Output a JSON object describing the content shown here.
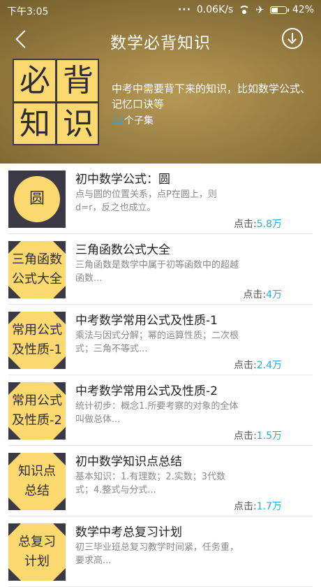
{
  "status_bar": {
    "time": "下午3:05",
    "speed": "0.06K/s",
    "battery": "42%"
  },
  "header": {
    "title": "数学必背知识",
    "description": "中考中需要背下来的知识，比如数学公式、记忆口诀等",
    "subset_count": "12",
    "subset_suffix": "个子集"
  },
  "cover": {
    "chars": [
      "必",
      "背",
      "知",
      "识"
    ]
  },
  "clicks_label": "点击:",
  "items": [
    {
      "title": "初中数学公式：圆",
      "subtitle": "点与圆的位置关系，点P在圆上，则d=r，反之也成立。",
      "clicks": "5.8万",
      "thumb_lines": [
        "圆"
      ]
    },
    {
      "title": "三角函数公式大全",
      "subtitle": "三角函数是数学中属于初等函数中的超越函数...",
      "clicks": "4万",
      "thumb_lines": [
        "三角函数",
        "公式大全"
      ]
    },
    {
      "title": "中考数学常用公式及性质-1",
      "subtitle": "乘法与因式分解；幂的运算性质；二次根式；三角不等式...",
      "clicks": "2.4万",
      "thumb_lines": [
        "常用公式",
        "及性质-1"
      ]
    },
    {
      "title": "中考数学常用公式及性质-2",
      "subtitle": "统计初步：概念1.所要考察的对象的全体叫做总体...",
      "clicks": "1.5万",
      "thumb_lines": [
        "常用公式",
        "及性质-2"
      ]
    },
    {
      "title": "初中数学知识点总结",
      "subtitle": "基本知识：1.有理数；2.实数；3代数式；4.整式与分式...",
      "clicks": "1.7万",
      "thumb_lines": [
        "知识点",
        "总结"
      ]
    },
    {
      "title": "数学中考总复习计划",
      "subtitle": "初三毕业班总复习教学时间紧，任务重，要求高...",
      "clicks": "",
      "thumb_lines": [
        "总复习",
        "计划"
      ]
    }
  ]
}
